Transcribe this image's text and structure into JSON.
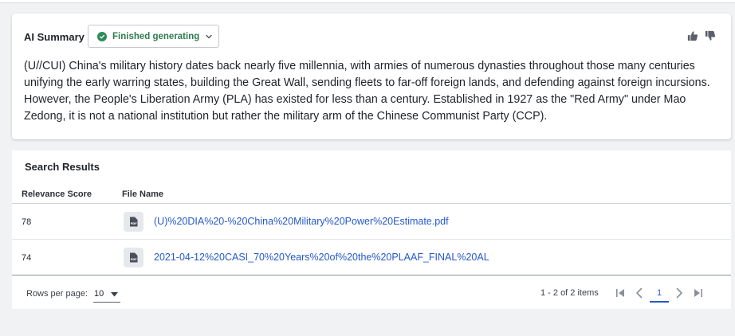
{
  "ai_summary": {
    "title": "AI Summary",
    "status_label": "Finished generating",
    "text": "(U//CUI) China's military history dates back nearly five millennia, with armies of numerous dynasties throughout those many centuries unifying the early warring states, building the Great Wall, sending fleets to far-off foreign lands, and defending against foreign incursions. However, the People's Liberation Army (PLA) has existed for less than a century. Established in 1927 as the \"Red Army\" under Mao Zedong, it is not a national institution but rather the military arm of the Chinese Communist Party (CCP)."
  },
  "search_results": {
    "title": "Search Results",
    "columns": [
      "Relevance Score",
      "File Name"
    ],
    "rows": [
      {
        "score": "78",
        "file_name": "(U)%20DIA%20-%20China%20Military%20Power%20Estimate.pdf"
      },
      {
        "score": "74",
        "file_name": "2021-04-12%20CASI_70%20Years%20of%20the%20PLAAF_FINAL%20AL"
      }
    ],
    "icons": {
      "file": "pdf-file-icon"
    }
  },
  "pagination": {
    "rows_per_page_label": "Rows per page:",
    "rows_per_page_value": "10",
    "items_text": "1 - 2 of 2 items",
    "current_page": "1"
  },
  "colors": {
    "accent": "#2558c9",
    "success": "#2e8b57",
    "background": "#f1f2f4"
  }
}
